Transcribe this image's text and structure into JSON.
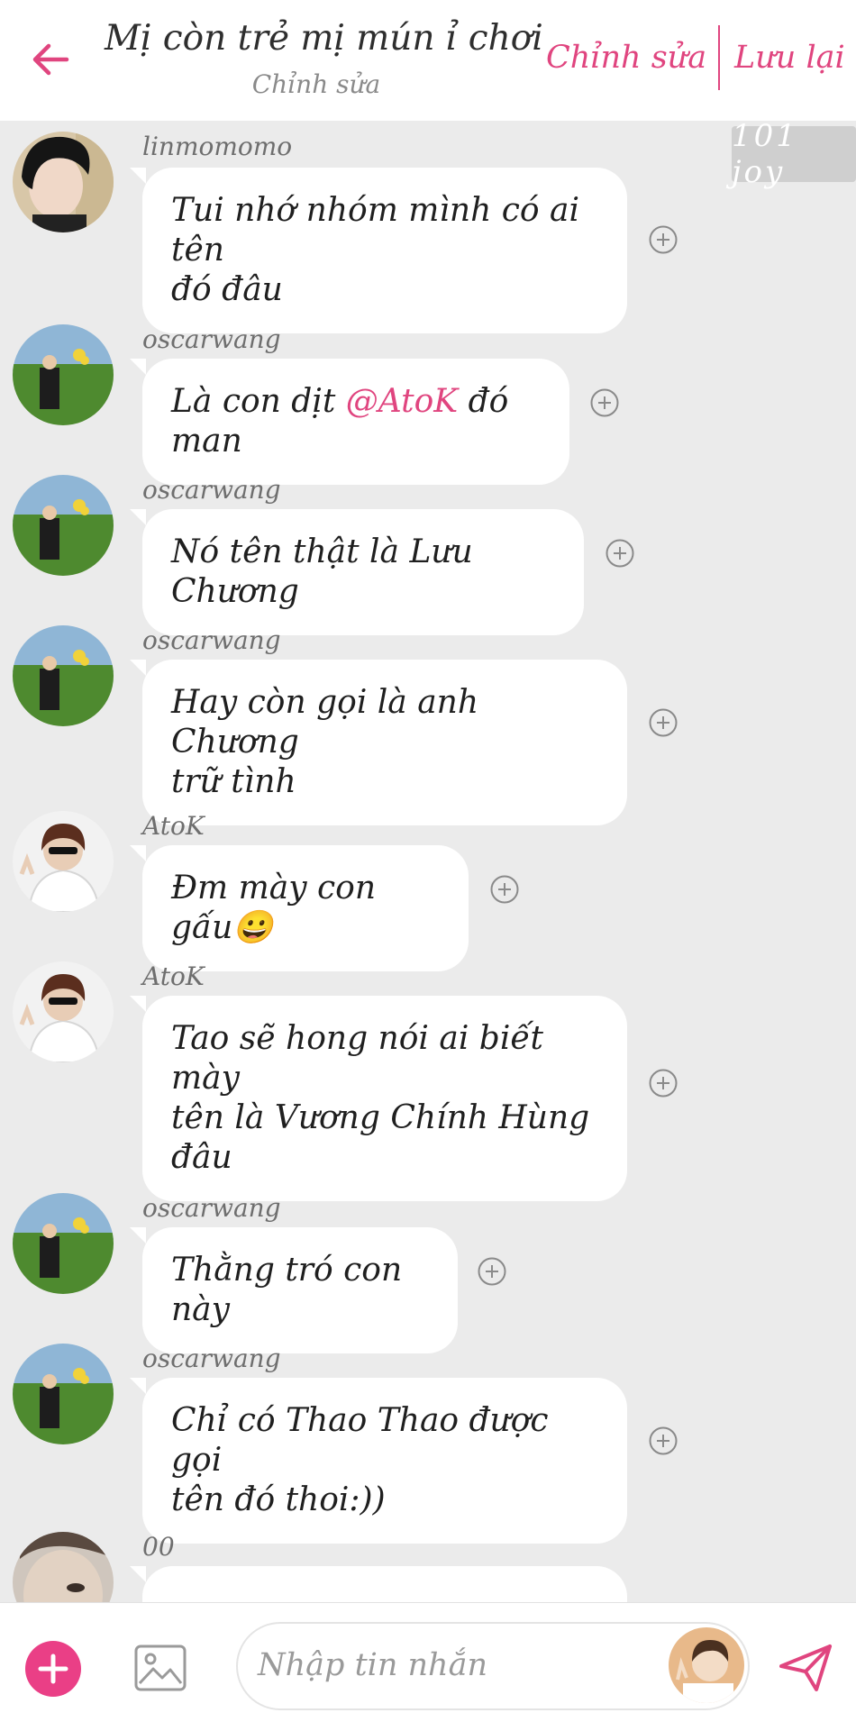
{
  "header": {
    "title": "Mị còn trẻ mị mún ỉ chơi",
    "subtitle": "Chỉnh sửa",
    "edit_label": "Chỉnh sửa",
    "save_label": "Lưu lại",
    "accent_color": "#e0457f"
  },
  "watermark": {
    "text": "101 joy"
  },
  "messages": [
    {
      "user": "linmomomo",
      "lines": [
        "Tui nhớ nhóm mình có ai tên",
        "đó đâu"
      ]
    },
    {
      "user": "oscarwang",
      "before": "Là con dịt ",
      "mention": "@AtoK",
      "after": " đó man"
    },
    {
      "user": "oscarwang",
      "lines": [
        "Nó tên thật là Lưu Chương"
      ]
    },
    {
      "user": "oscarwang",
      "lines": [
        "Hay còn gọi là anh Chương",
        "trữ tình"
      ]
    },
    {
      "user": "AtoK",
      "lines": [
        "Đm mày con gấu😀"
      ]
    },
    {
      "user": "AtoK",
      "lines": [
        "Tao sẽ hong nói ai biết mày",
        "tên là Vương Chính Hùng",
        "đâu"
      ]
    },
    {
      "user": "oscarwang",
      "lines": [
        "Thằng tró con này"
      ]
    },
    {
      "user": "oscarwang",
      "lines": [
        "Chỉ có Thao Thao được gọi",
        "tên đó thoi:))"
      ]
    },
    {
      "user": "00"
    }
  ],
  "composer": {
    "placeholder": "Nhập tin nhắn",
    "plus_icon": "plus-icon",
    "image_icon": "image-icon",
    "send_icon": "send-icon"
  }
}
